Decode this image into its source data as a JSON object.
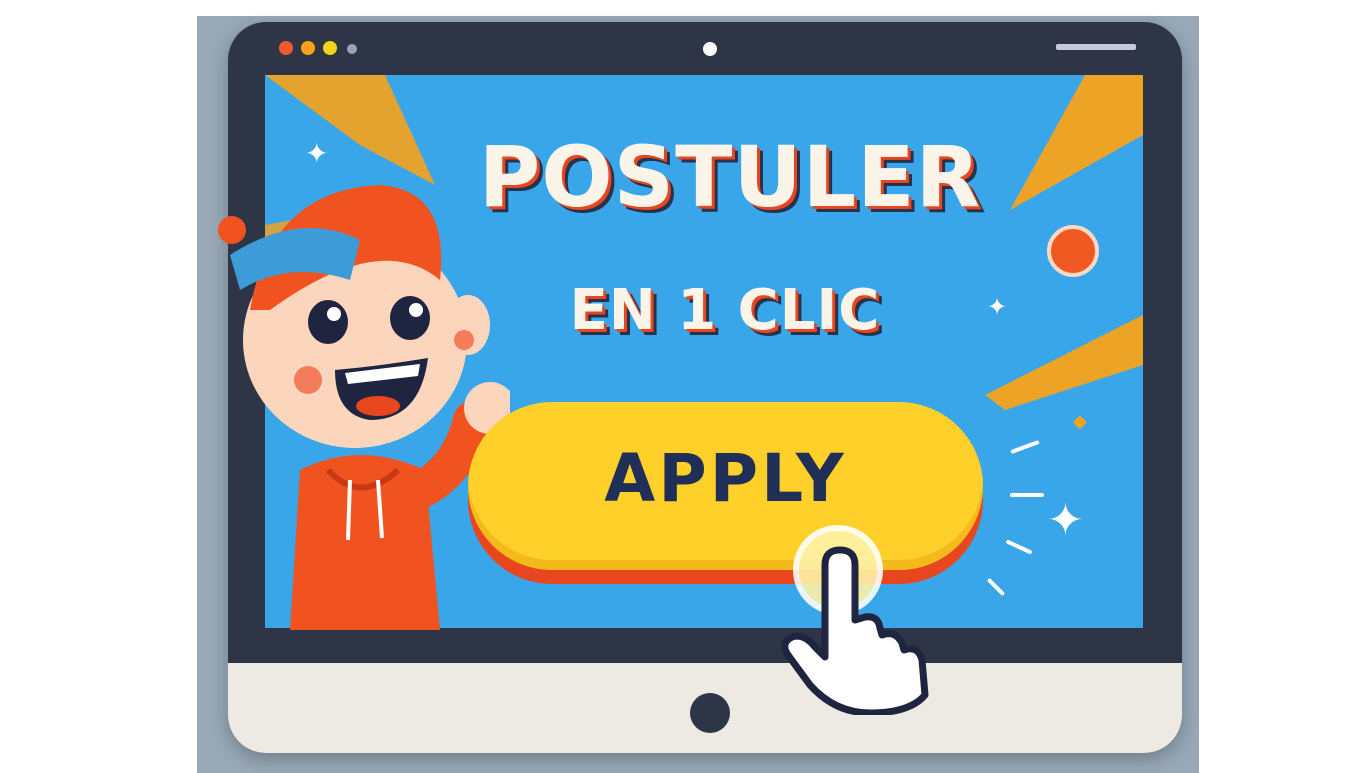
{
  "headline": {
    "line1": "POSTULER",
    "line2": "EN 1 CLIC"
  },
  "cta": {
    "label": "APPLY"
  },
  "icons": [
    "window-dots-icon",
    "camera-icon",
    "sparkle-icon",
    "pointer-hand-icon",
    "power-icon"
  ],
  "colors": {
    "screen": "#3aa6ea",
    "bezel": "#2e3547",
    "button": "#ffd02a",
    "button_text": "#1f2f58",
    "accent": "#e8461f",
    "headline_text": "#fbf4e9"
  }
}
